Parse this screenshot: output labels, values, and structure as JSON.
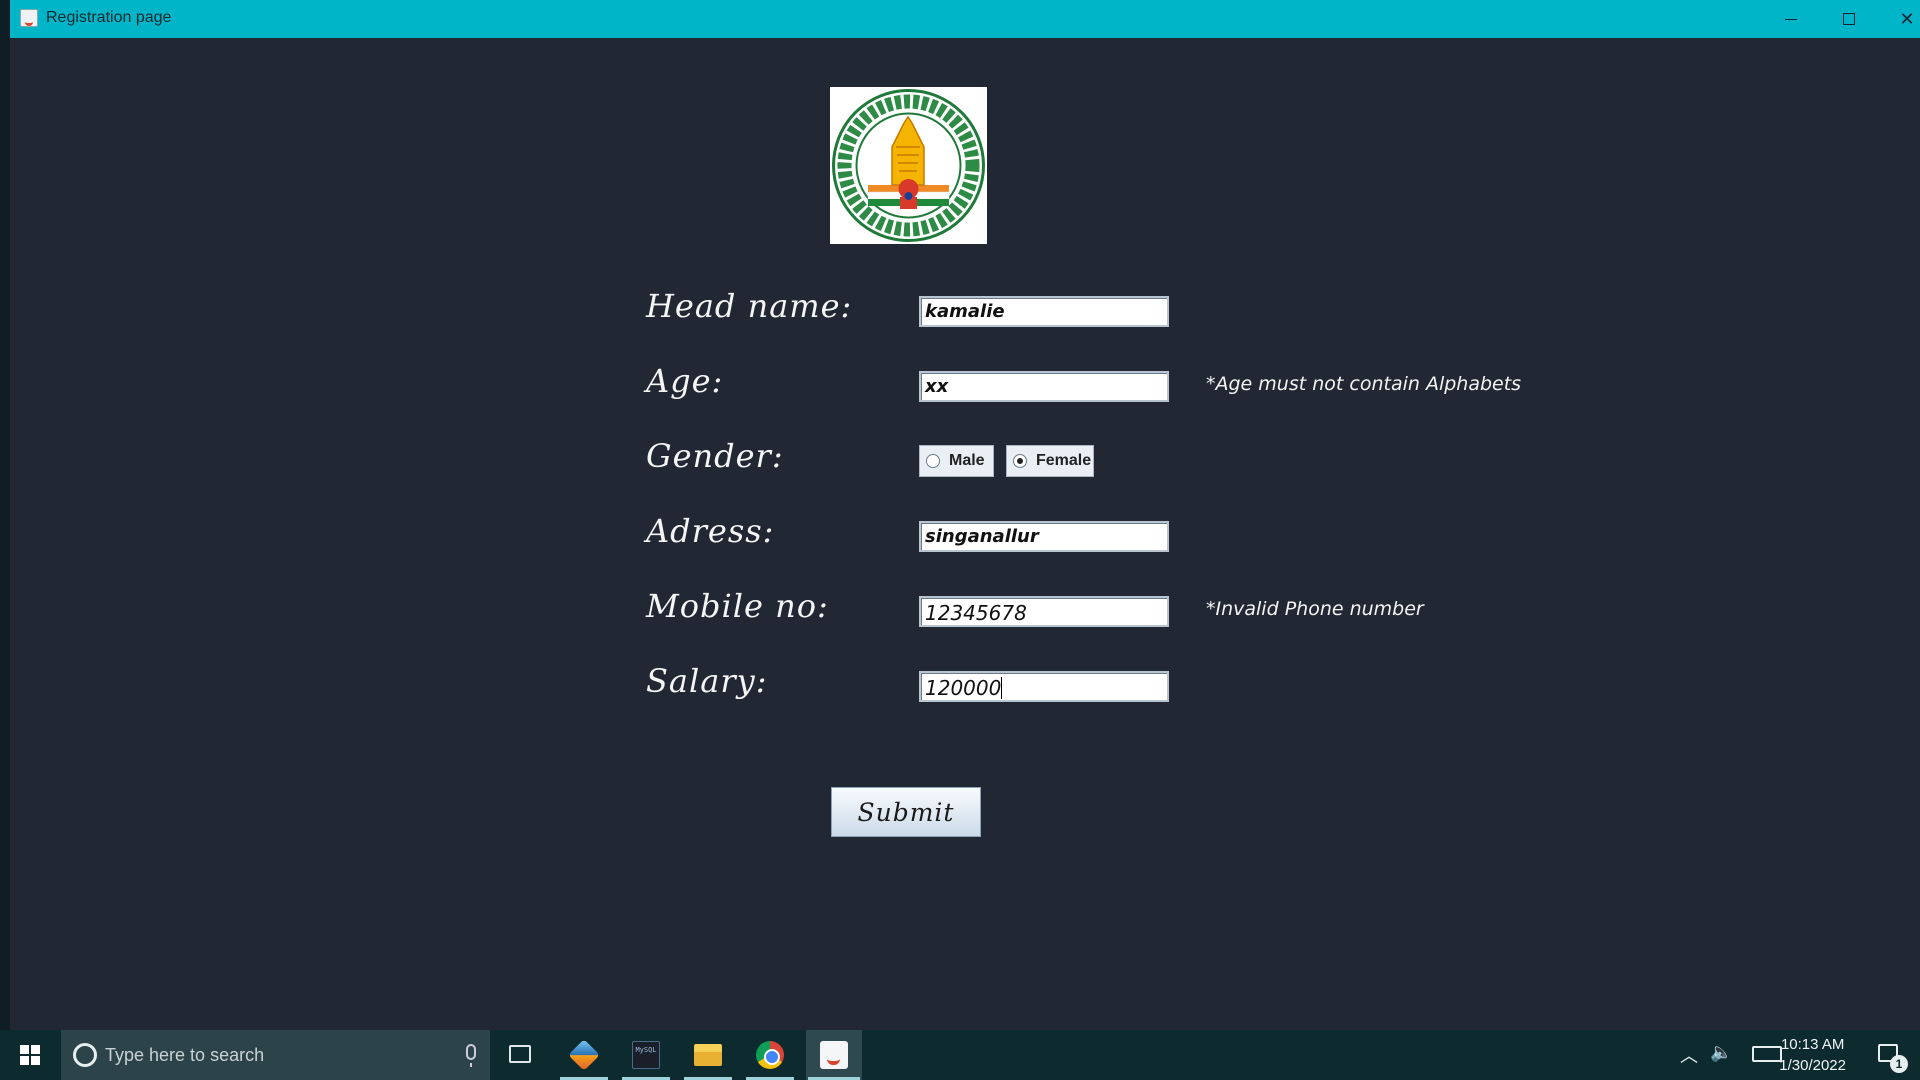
{
  "window": {
    "title": "Registration page",
    "icon": "java-cup-icon"
  },
  "emblem": {
    "description_icon": "tamil-nadu-emblem-icon"
  },
  "form": {
    "head_name": {
      "label": "Head name:",
      "value": "kamalie"
    },
    "age": {
      "label": "Age:",
      "value": "xx",
      "error": "*Age must not contain Alphabets"
    },
    "gender": {
      "label": "Gender:",
      "options": [
        "Male",
        "Female"
      ],
      "selected": "Female"
    },
    "address": {
      "label": "Adress:",
      "value": "singanallur"
    },
    "mobile": {
      "label": "Mobile no:",
      "value": "12345678",
      "error": "*Invalid Phone number"
    },
    "salary": {
      "label": "Salary:",
      "value": "120000"
    },
    "submit_label": "Submit"
  },
  "taskbar": {
    "search_placeholder": "Type here to search",
    "apps": [
      "netbeans-icon",
      "mysql-icon",
      "file-explorer-icon",
      "chrome-icon",
      "java-icon"
    ],
    "active_app": "java-icon",
    "mysql_label": "MySQL",
    "time": "10:13 AM",
    "date": "1/30/2022",
    "notification_count": "1"
  },
  "colors": {
    "title_bar": "#00b5c8",
    "background": "#212833",
    "taskbar": "#0d2a2f"
  }
}
